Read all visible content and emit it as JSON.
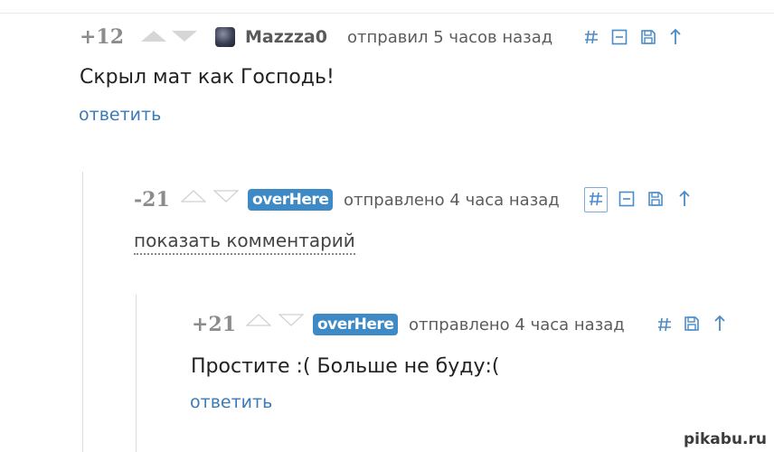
{
  "comments": [
    {
      "rating": "+12",
      "username": "Mazzza0",
      "meta": "отправил 5 часов назад",
      "text": "Скрыл мат как Господь!",
      "reply": "ответить"
    },
    {
      "rating": "-21",
      "username": "overHere",
      "meta": "отправлено 4 часа назад",
      "show_link": "показать комментарий"
    },
    {
      "rating": "+21",
      "username": "overHere",
      "meta": "отправлено 4 часа назад",
      "text": "Простите :( Больше не буду:(",
      "reply": "ответить"
    }
  ],
  "watermark": "pikabu.ru",
  "icons": [
    "hash-icon",
    "collapse-icon",
    "save-icon",
    "up-icon"
  ],
  "colors": {
    "accent": "#3d8ac6",
    "link": "#3b7ab8",
    "rating": "#8c8c8c"
  }
}
